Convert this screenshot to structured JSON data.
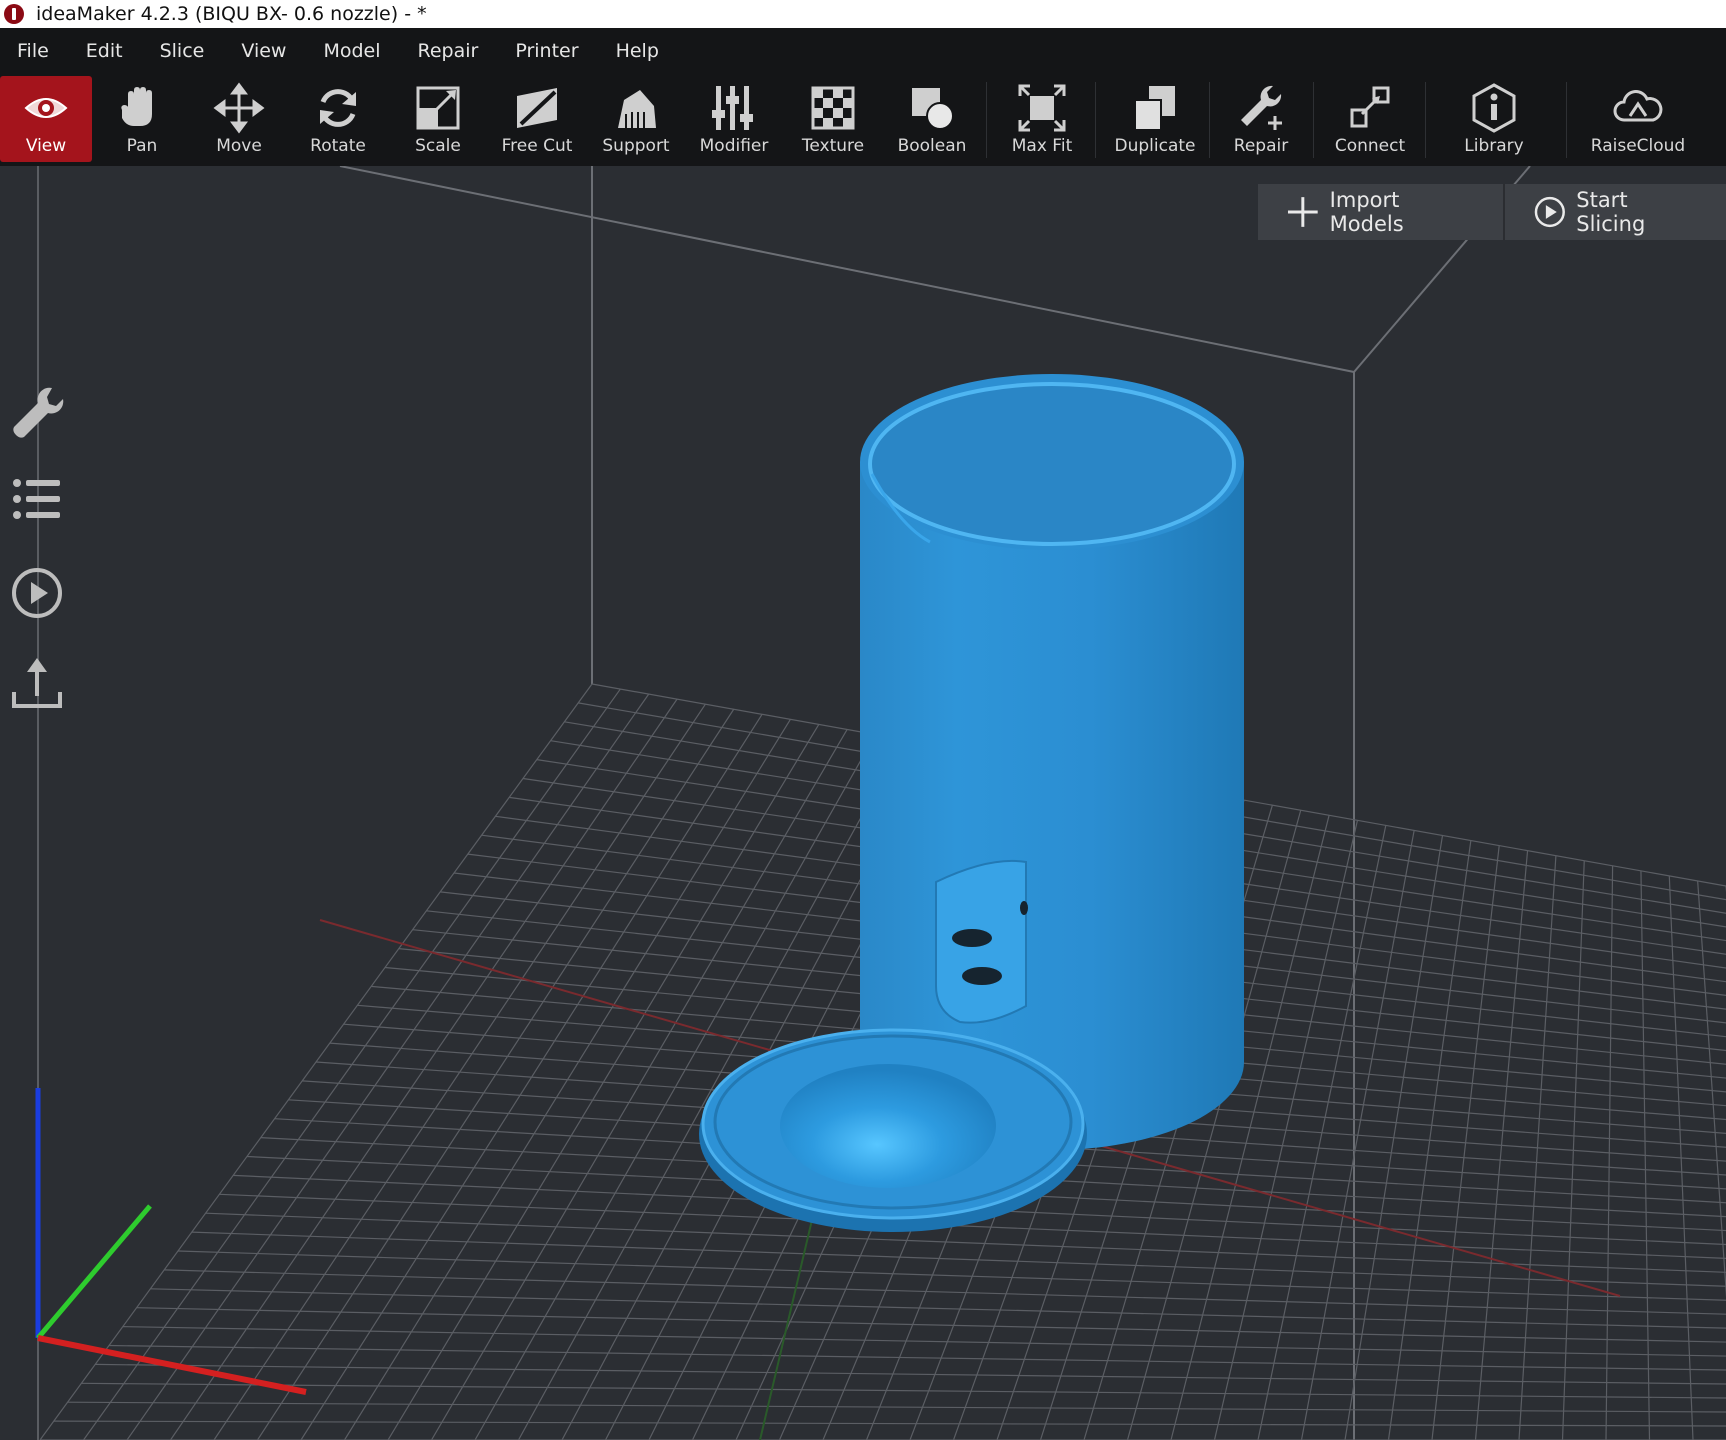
{
  "window": {
    "title": "ideaMaker 4.2.3 (BIQU BX- 0.6 nozzle) - *"
  },
  "menu": [
    "File",
    "Edit",
    "Slice",
    "View",
    "Model",
    "Repair",
    "Printer",
    "Help"
  ],
  "toolbar": {
    "active_tool": "View",
    "active_color": "#a4141c",
    "tools": [
      {
        "label": "View",
        "icon": "eye-icon"
      },
      {
        "label": "Pan",
        "icon": "hand-icon"
      },
      {
        "label": "Move",
        "icon": "move-arrows-icon"
      },
      {
        "label": "Rotate",
        "icon": "rotate-icon"
      },
      {
        "label": "Scale",
        "icon": "scale-icon"
      },
      {
        "label": "Free Cut",
        "icon": "free-cut-icon"
      },
      {
        "label": "Support",
        "icon": "support-icon"
      },
      {
        "label": "Modifier",
        "icon": "modifier-icon"
      },
      {
        "label": "Texture",
        "icon": "texture-icon"
      },
      {
        "label": "Boolean",
        "icon": "boolean-icon"
      },
      {
        "label": "Max Fit",
        "icon": "max-fit-icon"
      },
      {
        "label": "Duplicate",
        "icon": "duplicate-icon"
      },
      {
        "label": "Repair",
        "icon": "repair-wrench-icon"
      },
      {
        "label": "Connect",
        "icon": "connect-icon"
      },
      {
        "label": "Library",
        "icon": "library-icon"
      },
      {
        "label": "RaiseCloud",
        "icon": "cloud-icon"
      }
    ]
  },
  "actions": {
    "import_label": "Import Models",
    "slice_label": "Start Slicing"
  },
  "sidebar": [
    "wrench-icon",
    "list-icon",
    "play-icon",
    "upload-icon"
  ],
  "scene": {
    "model_color": "#2d93d6",
    "axis_colors": {
      "x": "#d42020",
      "y": "#2ecc2e",
      "z": "#1a3de0"
    }
  }
}
